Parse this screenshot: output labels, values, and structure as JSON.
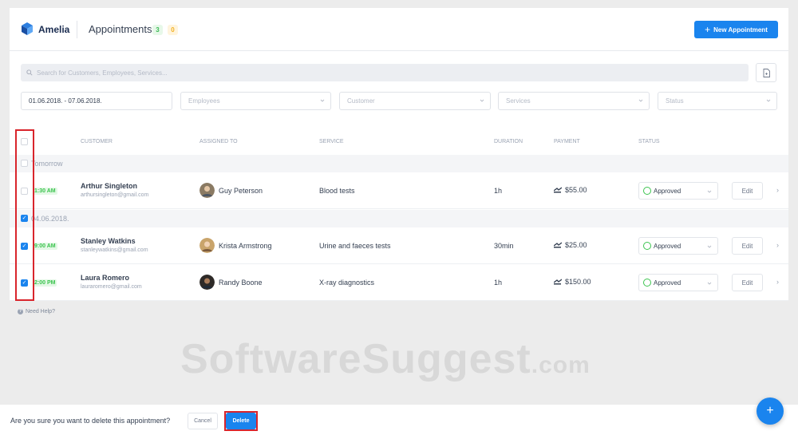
{
  "header": {
    "brand": "Amelia",
    "title": "Appointments",
    "count_green": "3",
    "count_yellow": "0",
    "new_button_label": "New Appointment"
  },
  "search": {
    "placeholder": "Search for Customers, Employees, Services..."
  },
  "filters": {
    "date_range": "01.06.2018. - 07.06.2018.",
    "employees": "Employees",
    "customer": "Customer",
    "services": "Services",
    "status": "Status"
  },
  "columns": {
    "customer": "Customer",
    "assigned": "Assigned to",
    "service": "Service",
    "duration": "Duration",
    "payment": "Payment",
    "status": "Status"
  },
  "groups": [
    {
      "label": "Tomorrow",
      "rows": [
        {
          "time": "1:30 AM",
          "customer": "Arthur Singleton",
          "email": "arthursingleton@gmail.com",
          "employee": "Guy Peterson",
          "service": "Blood tests",
          "duration": "1h",
          "payment": "$55.00",
          "status": "Approved",
          "action": "Edit"
        }
      ]
    },
    {
      "label": "04.06.2018.",
      "rows": [
        {
          "time": "9:00 AM",
          "customer": "Stanley Watkins",
          "email": "stanleywatkins@gmail.com",
          "employee": "Krista Armstrong",
          "service": "Urine and faeces tests",
          "duration": "30min",
          "payment": "$25.00",
          "status": "Approved",
          "action": "Edit"
        },
        {
          "time": "2:00 PM",
          "customer": "Laura Romero",
          "email": "lauraromero@gmail.com",
          "employee": "Randy Boone",
          "service": "X-ray diagnostics",
          "duration": "1h",
          "payment": "$150.00",
          "status": "Approved",
          "action": "Edit"
        }
      ]
    }
  ],
  "help": "Need Help?",
  "watermark": {
    "main": "SoftwareSuggest",
    "suffix": ".com"
  },
  "confirm_bar": {
    "question": "Are you sure you want to delete this appointment?",
    "cancel": "Cancel",
    "delete": "Delete"
  },
  "fab_label": "+",
  "colors": {
    "accent": "#1a84ee",
    "success": "#3cc44f",
    "warning": "#f2b022",
    "highlight": "#d9252c"
  }
}
